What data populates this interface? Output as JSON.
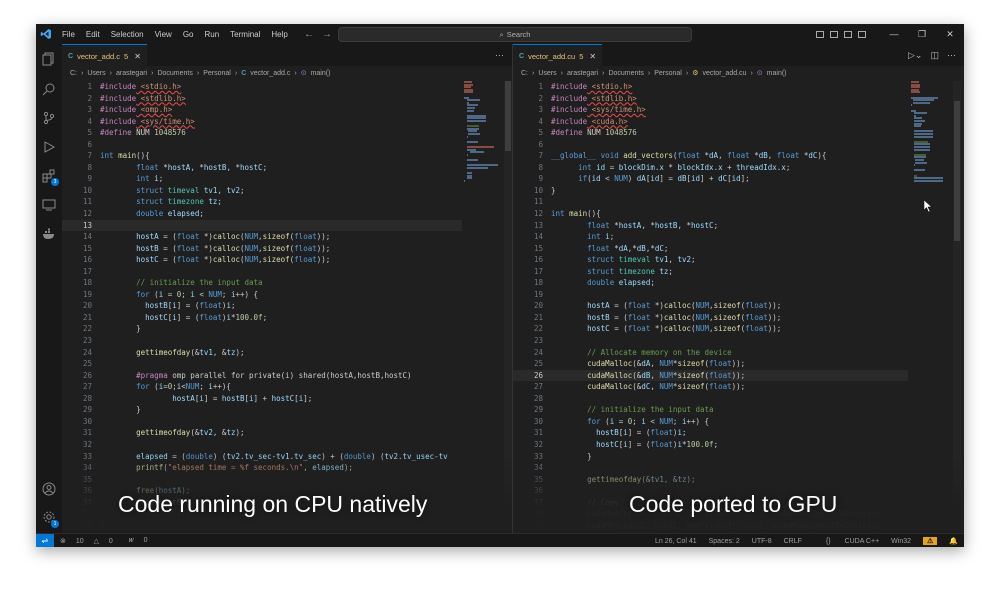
{
  "menu": [
    "File",
    "Edit",
    "Selection",
    "View",
    "Go",
    "Run",
    "Terminal",
    "Help"
  ],
  "search": {
    "placeholder": "Search"
  },
  "left": {
    "tab": {
      "name": "vector_add.c",
      "problems": "5",
      "lang_icon": "C"
    },
    "breadcrumb": [
      "C:",
      "Users",
      "arastegari",
      "Documents",
      "Personal",
      "vector_add.c",
      "main()"
    ],
    "caption": "Code running on CPU natively",
    "current_line": 13,
    "lines": [
      [
        1,
        "#include <stdio.h>"
      ],
      [
        2,
        "#include <stdlib.h>"
      ],
      [
        3,
        "#include <omp.h>"
      ],
      [
        4,
        "#include <sys/time.h>"
      ],
      [
        5,
        "#define NUM 1048576"
      ],
      [
        6,
        ""
      ],
      [
        7,
        "int main(){"
      ],
      [
        8,
        "        float *hostA, *hostB, *hostC;"
      ],
      [
        9,
        "        int i;"
      ],
      [
        10,
        "        struct timeval tv1, tv2;"
      ],
      [
        11,
        "        struct timezone tz;"
      ],
      [
        12,
        "        double elapsed;"
      ],
      [
        13,
        ""
      ],
      [
        14,
        "        hostA = (float *)calloc(NUM,sizeof(float));"
      ],
      [
        15,
        "        hostB = (float *)calloc(NUM,sizeof(float));"
      ],
      [
        16,
        "        hostC = (float *)calloc(NUM,sizeof(float));"
      ],
      [
        17,
        ""
      ],
      [
        18,
        "        // initialize the input data"
      ],
      [
        19,
        "        for (i = 0; i < NUM; i++) {"
      ],
      [
        20,
        "          hostB[i] = (float)i;"
      ],
      [
        21,
        "          hostC[i] = (float)i*100.0f;"
      ],
      [
        22,
        "        }"
      ],
      [
        23,
        ""
      ],
      [
        24,
        "        gettimeofday(&tv1, &tz);"
      ],
      [
        25,
        ""
      ],
      [
        26,
        "        #pragma omp parallel for private(i) shared(hostA,hostB,hostC)"
      ],
      [
        27,
        "        for (i=0;i<NUM; i++){"
      ],
      [
        28,
        "                hostA[i] = hostB[i] + hostC[i];"
      ],
      [
        29,
        "        }"
      ],
      [
        30,
        ""
      ],
      [
        31,
        "        gettimeofday(&tv2, &tz);"
      ],
      [
        32,
        ""
      ],
      [
        33,
        "        elapsed = (double) (tv2.tv_sec-tv1.tv_sec) + (double) (tv2.tv_usec-tv"
      ],
      [
        34,
        "        printf(\"elapsed time = %f seconds.\\n\", elapsed);"
      ],
      [
        35,
        ""
      ],
      [
        36,
        "        free(hostA);"
      ],
      [
        37,
        "        free(hostB);"
      ],
      [
        38,
        "        free(hostC);"
      ],
      [
        39,
        "}"
      ]
    ]
  },
  "right": {
    "tab": {
      "name": "vector_add.cu",
      "problems": "5",
      "lang_icon": "C"
    },
    "breadcrumb": [
      "C:",
      "Users",
      "arastegari",
      "Documents",
      "Personal",
      "vector_add.cu",
      "main()"
    ],
    "caption": "Code ported to GPU",
    "current_line": 26,
    "lines": [
      [
        1,
        "#include <stdio.h>"
      ],
      [
        2,
        "#include <stdlib.h>"
      ],
      [
        3,
        "#include <sys/time.h>"
      ],
      [
        4,
        "#include <cuda.h>"
      ],
      [
        5,
        "#define NUM 1048576"
      ],
      [
        6,
        ""
      ],
      [
        7,
        "__global__ void add_vectors(float *dA, float *dB, float *dC){"
      ],
      [
        8,
        "      int id = blockDim.x * blockIdx.x + threadIdx.x;"
      ],
      [
        9,
        "      if(id < NUM) dA[id] = dB[id] + dC[id];"
      ],
      [
        10,
        "}"
      ],
      [
        11,
        ""
      ],
      [
        12,
        "int main(){"
      ],
      [
        13,
        "        float *hostA, *hostB, *hostC;"
      ],
      [
        14,
        "        int i;"
      ],
      [
        15,
        "        float *dA,*dB,*dC;"
      ],
      [
        16,
        "        struct timeval tv1, tv2;"
      ],
      [
        17,
        "        struct timezone tz;"
      ],
      [
        18,
        "        double elapsed;"
      ],
      [
        19,
        ""
      ],
      [
        20,
        "        hostA = (float *)calloc(NUM,sizeof(float));"
      ],
      [
        21,
        "        hostB = (float *)calloc(NUM,sizeof(float));"
      ],
      [
        22,
        "        hostC = (float *)calloc(NUM,sizeof(float));"
      ],
      [
        23,
        ""
      ],
      [
        24,
        "        // Allocate memory on the device"
      ],
      [
        25,
        "        cudaMalloc(&dA, NUM*sizeof(float));"
      ],
      [
        26,
        "        cudaMalloc(&dB, NUM*sizeof(float));"
      ],
      [
        27,
        "        cudaMalloc(&dC, NUM*sizeof(float));"
      ],
      [
        28,
        ""
      ],
      [
        29,
        "        // initialize the input data"
      ],
      [
        30,
        "        for (i = 0; i < NUM; i++) {"
      ],
      [
        31,
        "          hostB[i] = (float)i;"
      ],
      [
        32,
        "          hostC[i] = (float)i*100.0f;"
      ],
      [
        33,
        "        }"
      ],
      [
        34,
        ""
      ],
      [
        35,
        "        gettimeofday(&tv1, &tz);"
      ],
      [
        36,
        ""
      ],
      [
        37,
        "        // Copy"
      ],
      [
        38,
        "        cudaMemcpy(dB, hostB, NUM*sizeof(float), cudaMemcpyHostToDevice);"
      ],
      [
        39,
        "        cudaMemcpy(dC, hostC, NUM*sizeof(float), cudaMemcpyHostToDevice);"
      ]
    ]
  },
  "status": {
    "errors": "10",
    "warnings": "0",
    "ports": "0",
    "position": "Ln 26, Col 41",
    "spaces": "Spaces: 2",
    "encoding": "UTF-8",
    "eol": "CRLF",
    "language": "CUDA C++",
    "platform": "Win32",
    "warn_icon": "⚠",
    "bell_icon": "🔔"
  },
  "colors": {
    "accent": "#0078d4",
    "editor_bg": "#1f1f1f",
    "tab_modified": "#e5c07b"
  }
}
